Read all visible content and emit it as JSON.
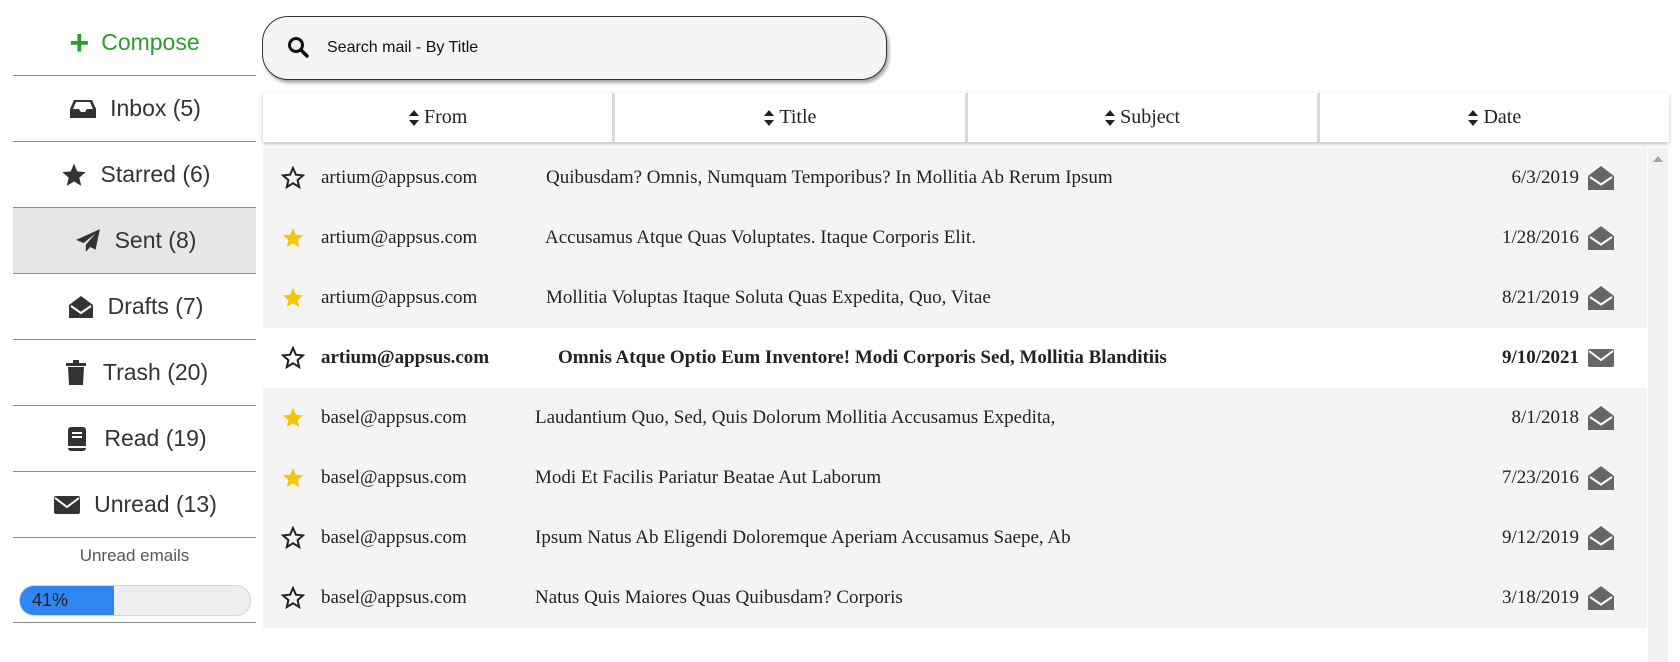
{
  "sidebar": {
    "compose_label": "Compose",
    "items": [
      {
        "label": "Inbox (5)",
        "icon": "inbox-icon"
      },
      {
        "label": "Starred (6)",
        "icon": "star-icon"
      },
      {
        "label": "Sent (8)",
        "icon": "paper-plane-icon",
        "active": true
      },
      {
        "label": "Drafts (7)",
        "icon": "envelope-open-icon"
      },
      {
        "label": "Trash (20)",
        "icon": "trash-icon"
      },
      {
        "label": "Read (19)",
        "icon": "book-icon"
      },
      {
        "label": "Unread (13)",
        "icon": "envelope-icon"
      }
    ],
    "progress": {
      "title": "Unread emails",
      "value_label": "41%",
      "percent": 41
    }
  },
  "search": {
    "placeholder": "Search mail - By Title"
  },
  "table": {
    "headers": [
      "From",
      "Title",
      "Subject",
      "Date"
    ],
    "rows": [
      {
        "from": "artium@appsus.com",
        "title": "Quibusdam? Omnis, Numquam Temporibus? In Mollitia Ab Rerum Ipsum",
        "date": "6/3/2019",
        "starred": false,
        "read": true
      },
      {
        "from": "artium@appsus.com",
        "title": "Accusamus Atque Quas Voluptates. Itaque Corporis Elit.",
        "date": "1/28/2016",
        "starred": true,
        "read": true
      },
      {
        "from": "artium@appsus.com",
        "title": "Mollitia Voluptas Itaque Soluta Quas Expedita, Quo, Vitae",
        "date": "8/21/2019",
        "starred": true,
        "read": true
      },
      {
        "from": "artium@appsus.com",
        "title": "Omnis Atque Optio Eum Inventore! Modi Corporis Sed, Mollitia Blanditiis",
        "date": "9/10/2021",
        "starred": false,
        "read": false
      },
      {
        "from": "basel@appsus.com",
        "title": "Laudantium Quo, Sed, Quis Dolorum Mollitia Accusamus Expedita,",
        "date": "8/1/2018",
        "starred": true,
        "read": true
      },
      {
        "from": "basel@appsus.com",
        "title": "Modi Et Facilis Pariatur Beatae Aut Laborum",
        "date": "7/23/2016",
        "starred": true,
        "read": true
      },
      {
        "from": "basel@appsus.com",
        "title": "Ipsum Natus Ab Eligendi Doloremque Aperiam Accusamus Saepe, Ab",
        "date": "9/12/2019",
        "starred": false,
        "read": true
      },
      {
        "from": "basel@appsus.com",
        "title": "Natus Quis Maiores Quas Quibusdam? Corporis",
        "date": "3/18/2019",
        "starred": false,
        "read": true
      }
    ]
  },
  "colors": {
    "compose": "#2c9c2a",
    "star_filled": "#f7c600",
    "progress": "#2f86f2",
    "row_bg": "#f3f4f3"
  }
}
